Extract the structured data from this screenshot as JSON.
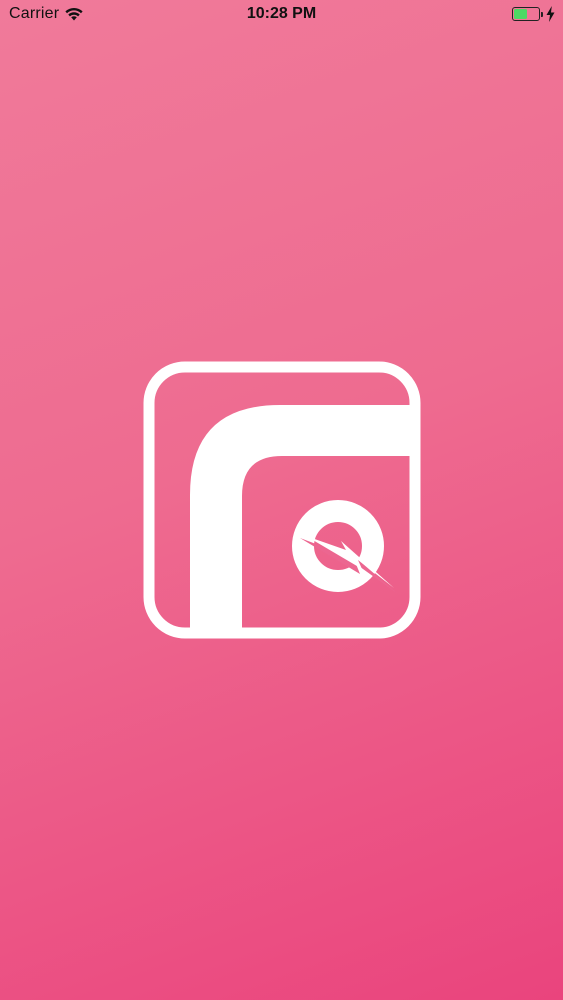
{
  "status_bar": {
    "carrier": "Carrier",
    "time": "10:28 PM",
    "battery_level": 0.55,
    "icons": {
      "signal": "wifi-icon",
      "battery": "battery-icon",
      "charging": "charging-bolt-icon"
    }
  },
  "splash": {
    "logo_icon": "fq-app-logo-icon"
  },
  "colors": {
    "background_top": "#f07a9a",
    "background_bottom": "#ea447d",
    "logo": "#ffffff",
    "battery_fill": "#4cd964"
  }
}
